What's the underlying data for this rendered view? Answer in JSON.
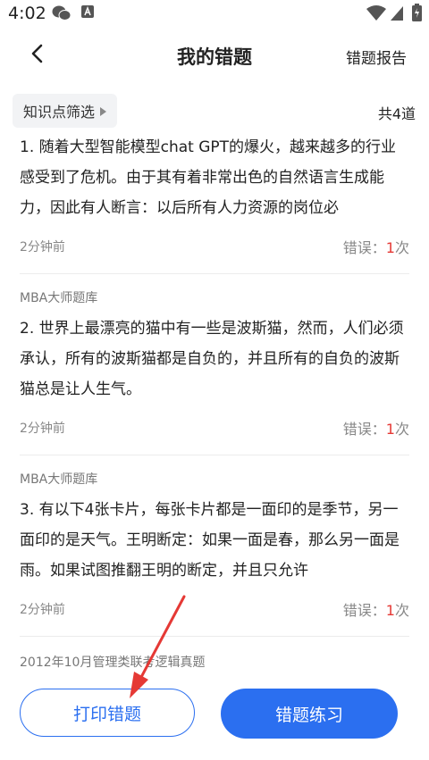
{
  "status_bar": {
    "time": "4:02"
  },
  "header": {
    "title": "我的错题",
    "report_label": "错题报告"
  },
  "filter": {
    "label": "知识点筛选",
    "count_text": "共4道"
  },
  "error_label": "错误：",
  "error_unit": "次",
  "questions": [
    {
      "source": "",
      "text": "1. 随着大型智能模型chat GPT的爆火，越来越多的行业感受到了危机。由于其有着非常出色的自然语言生成能力，因此有人断言：以后所有人力资源的岗位必",
      "time": "2分钟前",
      "errors": "1"
    },
    {
      "source": "MBA大师题库",
      "text": "2. 世界上最漂亮的猫中有一些是波斯猫，然而，人们必须承认，所有的波斯猫都是自负的，并且所有的自负的波斯猫总是让人生气。",
      "time": "2分钟前",
      "errors": "1"
    },
    {
      "source": "MBA大师题库",
      "text": "3. 有以下4张卡片，每张卡片都是一面印的是季节，另一面印的是天气。王明断定：如果一面是春，那么另一面是雨。如果试图推翻王明的断定，并且只允许",
      "time": "2分钟前",
      "errors": "1"
    }
  ],
  "partial_item": {
    "source": "2012年10月管理类联考逻辑真题"
  },
  "bottom": {
    "print_label": "打印错题",
    "practice_label": "错题练习"
  },
  "colors": {
    "accent": "#2b6ff0",
    "error": "#e53935",
    "arrow": "#e53935"
  }
}
